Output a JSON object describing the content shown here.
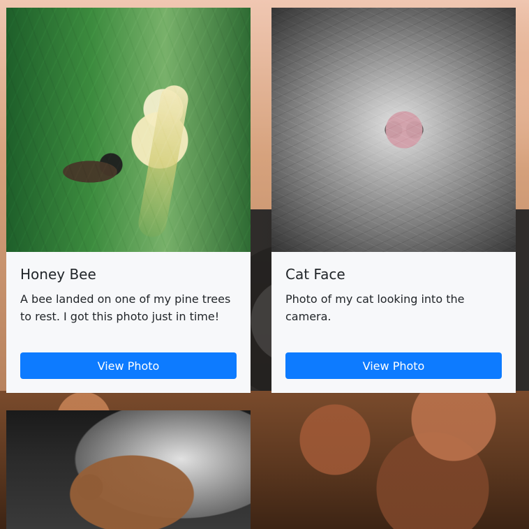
{
  "cards": [
    {
      "title": "Honey Bee",
      "description": "A bee landed on one of my pine trees to rest. I got this photo just in time!",
      "button_label": "View Photo",
      "image_icon": "bee-photo"
    },
    {
      "title": "Cat Face",
      "description": "Photo of my cat looking into the camera.",
      "button_label": "View Photo",
      "image_icon": "cat-photo"
    }
  ],
  "partial_tile": {
    "image_icon": "dog-photo"
  },
  "colors": {
    "card_background": "#f7f8fa",
    "primary_button": "#0d7bff",
    "text": "#212529"
  }
}
